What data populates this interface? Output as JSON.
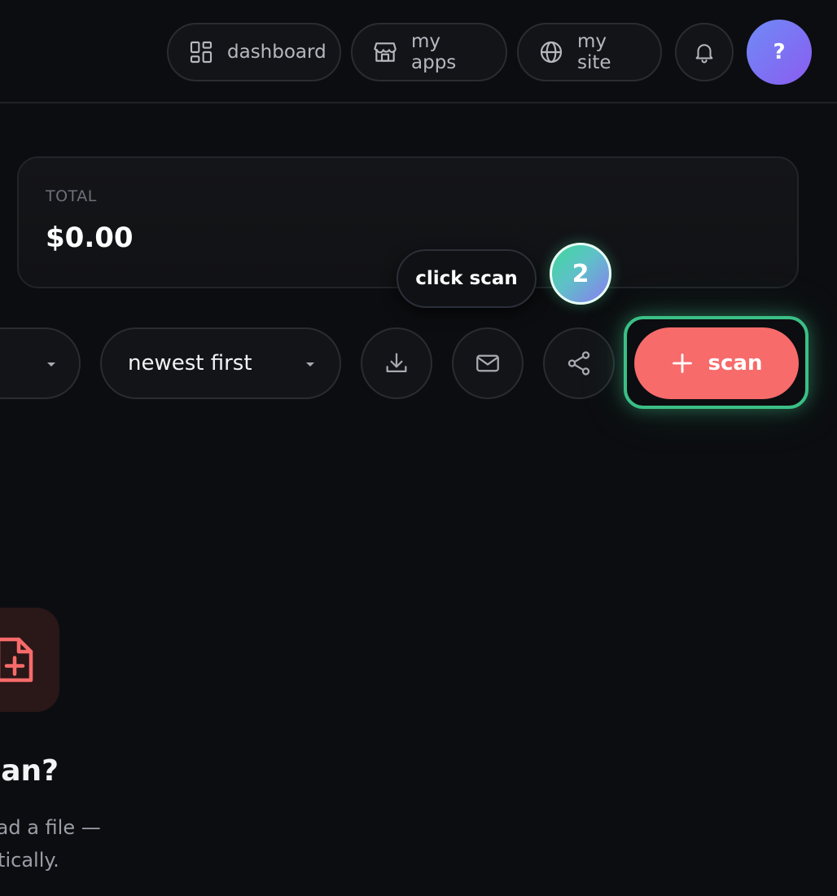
{
  "nav": {
    "dashboard_label": "dashboard",
    "my_apps_label": "my apps",
    "my_site_label": "my site",
    "avatar_text": "?"
  },
  "summary": {
    "total_label": "TOTAL",
    "total_value": "$0.00"
  },
  "onboarding": {
    "tooltip_text": "click scan",
    "step_number": "2"
  },
  "controls": {
    "sort_value": "newest first",
    "scan_label": "scan"
  },
  "empty_state": {
    "title": "to scan?",
    "line1": "eceipt or upload a file —",
    "line2": "acted automatically."
  },
  "colors": {
    "background": "#0c0d10",
    "accent_scan": "#f76b6b",
    "highlight": "#3bbf86",
    "avatar_from": "#6f8bf6",
    "avatar_to": "#8a5cf0"
  },
  "icons": {
    "dashboard": "layout-grid-icon",
    "apps": "storefront-icon",
    "site": "globe-icon",
    "notifications": "bell-icon",
    "download": "download-icon",
    "mail": "mail-icon",
    "share": "share-icon",
    "scan": "plus-icon",
    "empty": "file-plus-icon"
  }
}
